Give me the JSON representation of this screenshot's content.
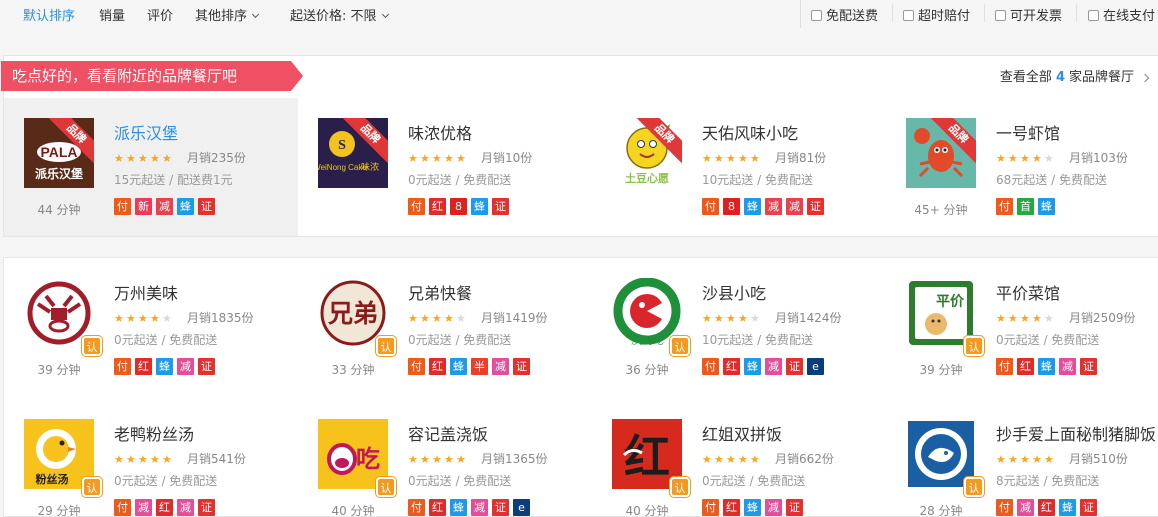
{
  "sortbar": {
    "default_label": "默认排序",
    "sales_label": "销量",
    "rating_label": "评价",
    "other_label": "其他排序",
    "min_price_label": "起送价格: 不限"
  },
  "filters": [
    "免配送费",
    "超时赔付",
    "可开发票",
    "在线支付"
  ],
  "brand_section": {
    "banner": "吃点好的，看看附近的品牌餐厅吧",
    "view_all_prefix": "查看全部",
    "view_all_count": "4",
    "view_all_suffix": "家品牌餐厅"
  },
  "brand_restaurants": [
    {
      "name": "派乐汉堡",
      "ribbon": "品牌",
      "rating": 5,
      "sales": "月销235份",
      "delivery": "15元起送 / 配送费1元",
      "eta": "44 分钟",
      "tags": [
        [
          "付",
          "t-fu"
        ],
        [
          "新",
          "t-xin"
        ],
        [
          "减",
          "t-jian"
        ],
        [
          "蜂",
          "t-feng"
        ],
        [
          "证",
          "t-zheng"
        ]
      ],
      "logo": "pala",
      "logo_text": "PALA",
      "logo_sub": "派乐汉堡"
    },
    {
      "name": "味浓优格",
      "ribbon": "品牌",
      "rating": 5,
      "sales": "月销10份",
      "delivery": "0元起送 / 免费配送",
      "eta": "",
      "tags": [
        [
          "付",
          "t-fu"
        ],
        [
          "红",
          "t-hong"
        ],
        [
          "8",
          "t-8"
        ],
        [
          "蜂",
          "t-feng"
        ],
        [
          "证",
          "t-zheng"
        ]
      ],
      "logo": "weinong",
      "logo_text": "WeiNong Cake",
      "logo_sub": "味浓"
    },
    {
      "name": "天佑风味小吃",
      "ribbon": "品牌",
      "rating": 5,
      "sales": "月销81份",
      "delivery": "10元起送 / 免费配送",
      "eta": "",
      "tags": [
        [
          "付",
          "t-fu"
        ],
        [
          "8",
          "t-8"
        ],
        [
          "蜂",
          "t-feng"
        ],
        [
          "减",
          "t-jian"
        ],
        [
          "减",
          "t-jian"
        ],
        [
          "证",
          "t-zheng"
        ]
      ],
      "logo": "tudou",
      "logo_text": "土豆心愿"
    },
    {
      "name": "一号虾馆",
      "ribbon": "品牌",
      "rating": 4,
      "sales": "月销103份",
      "delivery": "68元起送 / 免费配送",
      "eta": "45+ 分钟",
      "tags": [
        [
          "付",
          "t-fu"
        ],
        [
          "首",
          "t-shou"
        ],
        [
          "蜂",
          "t-feng"
        ]
      ],
      "logo": "xia"
    }
  ],
  "nearby_restaurants": [
    {
      "name": "万州美味",
      "rating": 4,
      "sales": "月销1835份",
      "delivery": "0元起送 / 免费配送",
      "eta": "39 分钟",
      "badge": "认",
      "tags": [
        [
          "付",
          "t-fu"
        ],
        [
          "红",
          "t-hong"
        ],
        [
          "蜂",
          "t-feng"
        ],
        [
          "减",
          "t-jian2"
        ],
        [
          "证",
          "t-zheng"
        ]
      ],
      "logo": "wanzhou"
    },
    {
      "name": "兄弟快餐",
      "rating": 4,
      "sales": "月销1419份",
      "delivery": "0元起送 / 免费配送",
      "eta": "33 分钟",
      "badge": "认",
      "tags": [
        [
          "付",
          "t-fu"
        ],
        [
          "红",
          "t-hong"
        ],
        [
          "蜂",
          "t-feng"
        ],
        [
          "半",
          "t-ban"
        ],
        [
          "减",
          "t-jian2"
        ],
        [
          "证",
          "t-zheng"
        ]
      ],
      "logo": "xiongdi",
      "logo_text": "兄弟"
    },
    {
      "name": "沙县小吃",
      "rating": 4,
      "sales": "月销1424份",
      "delivery": "10元起送 / 免费配送",
      "eta": "36 分钟",
      "badge": "认",
      "tags": [
        [
          "付",
          "t-fu"
        ],
        [
          "红",
          "t-hong"
        ],
        [
          "蜂",
          "t-feng"
        ],
        [
          "减",
          "t-jian2"
        ],
        [
          "证",
          "t-zheng"
        ],
        [
          "e",
          "t-e"
        ]
      ],
      "logo": "shaxian",
      "logo_text": "沙县小吃"
    },
    {
      "name": "平价菜馆",
      "rating": 4,
      "sales": "月销2509份",
      "delivery": "0元起送 / 免费配送",
      "eta": "39 分钟",
      "badge": "认",
      "tags": [
        [
          "付",
          "t-fu"
        ],
        [
          "红",
          "t-hong"
        ],
        [
          "蜂",
          "t-feng"
        ],
        [
          "减",
          "t-jian2"
        ],
        [
          "证",
          "t-zheng"
        ]
      ],
      "logo": "pingjia",
      "logo_text": "平价"
    },
    {
      "name": "老鸭粉丝汤",
      "rating": 5,
      "sales": "月销541份",
      "delivery": "0元起送 / 免费配送",
      "eta": "29 分钟",
      "badge": "认",
      "tags": [
        [
          "付",
          "t-fu"
        ],
        [
          "减",
          "t-jian2"
        ],
        [
          "红",
          "t-hong"
        ],
        [
          "减",
          "t-jian2"
        ],
        [
          "证",
          "t-zheng"
        ]
      ],
      "logo": "laoya",
      "logo_text": "粉丝汤"
    },
    {
      "name": "容记盖浇饭",
      "rating": 5,
      "sales": "月销1365份",
      "delivery": "0元起送 / 免费配送",
      "eta": "40 分钟",
      "badge": "认",
      "tags": [
        [
          "付",
          "t-fu"
        ],
        [
          "红",
          "t-hong"
        ],
        [
          "蜂",
          "t-feng"
        ],
        [
          "减",
          "t-jian2"
        ],
        [
          "证",
          "t-zheng"
        ],
        [
          "e",
          "t-e"
        ]
      ],
      "logo": "rongji",
      "logo_text": "吃"
    },
    {
      "name": "红姐双拼饭",
      "rating": 5,
      "sales": "月销662份",
      "delivery": "0元起送 / 免费配送",
      "eta": "40 分钟",
      "badge": "认",
      "tags": [
        [
          "付",
          "t-fu"
        ],
        [
          "红",
          "t-hong"
        ],
        [
          "蜂",
          "t-feng"
        ],
        [
          "减",
          "t-jian2"
        ],
        [
          "证",
          "t-zheng"
        ]
      ],
      "logo": "hongjie",
      "logo_text": "红"
    },
    {
      "name": "抄手爱上面秘制猪脚饭",
      "rating": 5,
      "sales": "月销510份",
      "delivery": "8元起送 / 免费配送",
      "eta": "28 分钟",
      "badge": "认",
      "tags": [
        [
          "付",
          "t-fu"
        ],
        [
          "减",
          "t-jian2"
        ],
        [
          "红",
          "t-hong"
        ],
        [
          "蜂",
          "t-feng"
        ],
        [
          "证",
          "t-zheng"
        ]
      ],
      "logo": "chaoshou"
    }
  ],
  "colors": {
    "accent": "#2b8ee0",
    "banner": "#f05063",
    "star": "#f5a623",
    "badge": "#f49a1e"
  }
}
